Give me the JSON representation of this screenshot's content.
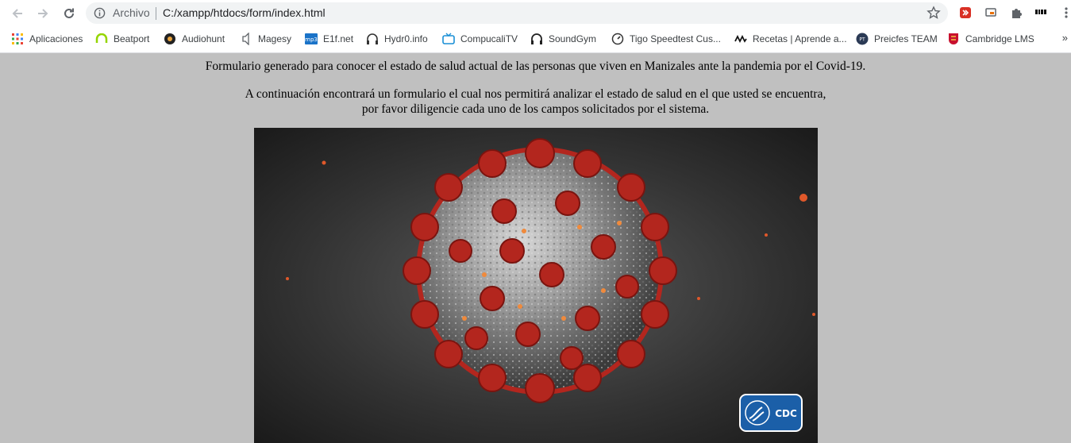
{
  "browser": {
    "omnibox": {
      "security_chip": "Archivo",
      "url": "C:/xampp/htdocs/form/index.html"
    },
    "bookmarks": [
      {
        "label": "Aplicaciones",
        "icon": "apps-grid-icon"
      },
      {
        "label": "Beatport",
        "icon": "beatport-icon"
      },
      {
        "label": "Audiohunt",
        "icon": "audiohunt-icon"
      },
      {
        "label": "Magesy",
        "icon": "magesy-icon"
      },
      {
        "label": "E1f.net",
        "icon": "mp3-icon"
      },
      {
        "label": "Hydr0.info",
        "icon": "headphones-icon"
      },
      {
        "label": "CompucaliTV",
        "icon": "tv-icon"
      },
      {
        "label": "SoundGym",
        "icon": "headphones-icon"
      },
      {
        "label": "Tigo Speedtest Cus...",
        "icon": "speedometer-icon"
      },
      {
        "label": "Recetas | Aprende a...",
        "icon": "recipes-icon"
      },
      {
        "label": "Preicfes TEAM",
        "icon": "preicfes-icon"
      },
      {
        "label": "Cambridge LMS",
        "icon": "cambridge-icon"
      }
    ],
    "more_bookmarks": "»"
  },
  "page": {
    "intro": "Formulario generado para conocer el estado de salud actual de las personas que viven en Manizales ante la pandemia por el Covid-19.",
    "instructions_line1": "A continuación encontrará un formulario el cual nos permitirá analizar el estado de salud en el que usted se encuentra,",
    "instructions_line2": "por favor diligencie cada uno de los campos solicitados por el sistema.",
    "hero_logo_text": "CDC"
  },
  "colors": {
    "page_background": "#c0c0c0",
    "virus_spike": "#b3261e",
    "virus_body": "#9a9a9a"
  }
}
